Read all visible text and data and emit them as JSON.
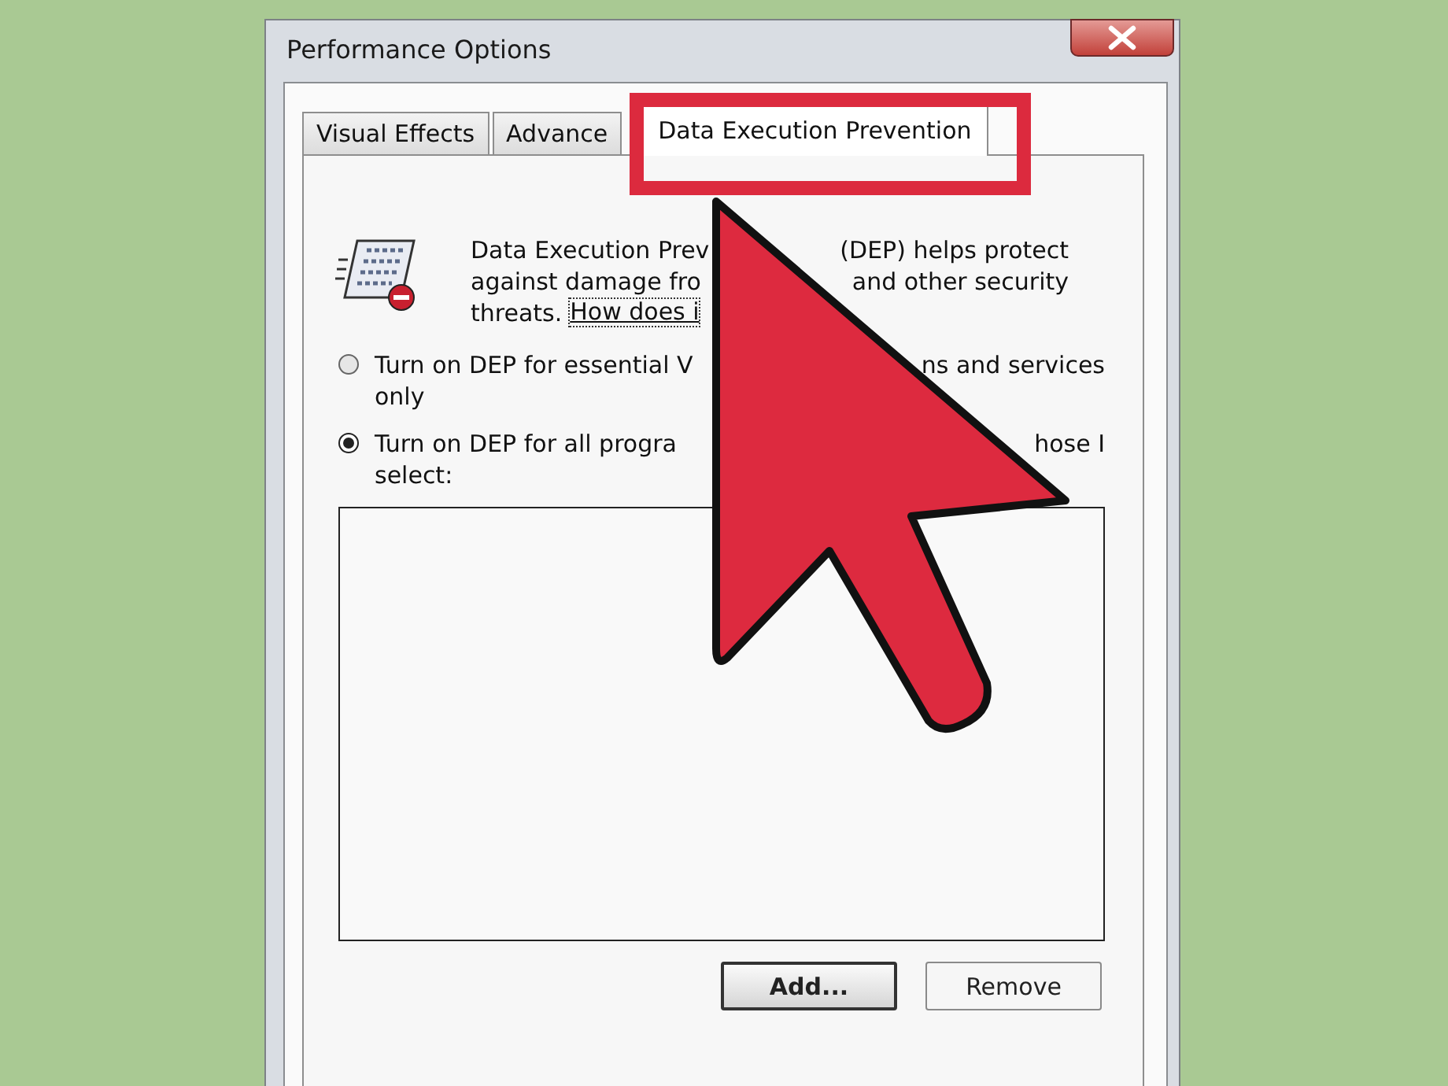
{
  "window": {
    "title": "Performance Options"
  },
  "tabs": [
    {
      "label": "Visual Effects",
      "selected": false
    },
    {
      "label": "Advance",
      "selected": false
    },
    {
      "label": "Data Execution Prevention",
      "selected": true
    }
  ],
  "description": {
    "lines": [
      {
        "left": "Data Execution Prev",
        "right": "(DEP) helps protect"
      },
      {
        "left": "against damage fro",
        "right": "and other security"
      },
      {
        "left": "threats.",
        "link": "How does i"
      }
    ]
  },
  "dep_options": [
    {
      "selected": false,
      "lines": [
        {
          "left": "Turn on DEP for essential V",
          "right": "ns and services"
        },
        {
          "left": "only"
        }
      ]
    },
    {
      "selected": true,
      "lines": [
        {
          "left": "Turn on DEP for all progra",
          "right": "hose I"
        },
        {
          "left": "select:"
        }
      ]
    }
  ],
  "buttons": [
    {
      "label": "Add...",
      "default": true
    },
    {
      "label": "Remove",
      "default": false
    }
  ]
}
